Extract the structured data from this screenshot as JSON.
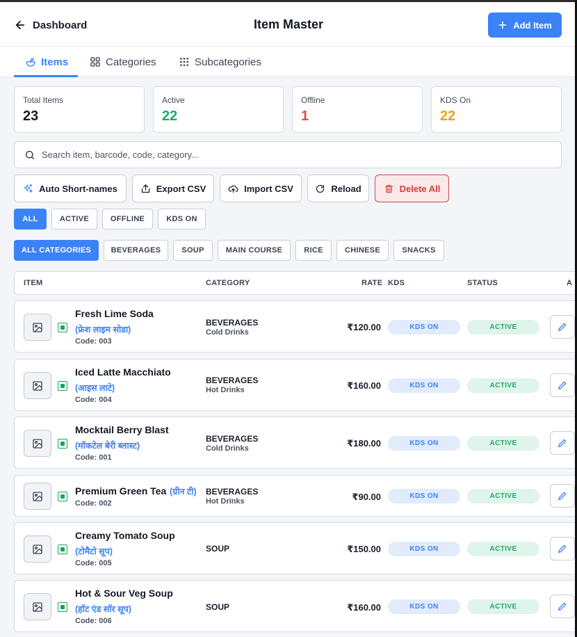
{
  "header": {
    "back_label": "Dashboard",
    "title": "Item Master",
    "add_label": "Add Item"
  },
  "tabs": [
    {
      "label": "Items",
      "active": true
    },
    {
      "label": "Categories",
      "active": false
    },
    {
      "label": "Subcategories",
      "active": false
    }
  ],
  "stats": [
    {
      "label": "Total Items",
      "value": "23",
      "color": "#141824"
    },
    {
      "label": "Active",
      "value": "22",
      "color": "#22a86a"
    },
    {
      "label": "Offline",
      "value": "1",
      "color": "#e04a4a"
    },
    {
      "label": "KDS On",
      "value": "22",
      "color": "#f0a020"
    }
  ],
  "search": {
    "placeholder": "Search item, barcode, code, category...",
    "value": ""
  },
  "actions": {
    "auto_short": "Auto Short-names",
    "export_csv": "Export CSV",
    "import_csv": "Import CSV",
    "reload": "Reload",
    "delete_all": "Delete All"
  },
  "status_filters": {
    "all": "ALL",
    "active": "ACTIVE",
    "offline": "OFFLINE",
    "kds_on": "KDS ON"
  },
  "category_filters": {
    "all": "ALL CATEGORIES",
    "beverages": "BEVERAGES",
    "soup": "SOUP",
    "main_course": "MAIN COURSE",
    "rice": "RICE",
    "chinese": "CHINESE",
    "snacks": "SNACKS"
  },
  "table": {
    "headers": {
      "item": "ITEM",
      "category": "CATEGORY",
      "rate": "RATE",
      "kds": "KDS",
      "status": "STATUS",
      "actions": "A"
    },
    "rows": [
      {
        "name": "Fresh Lime Soda",
        "alt": "(फ्रेश लाइम सोडा)",
        "code": "Code: 003",
        "category": "BEVERAGES",
        "subcategory": "Cold Drinks",
        "rate": "₹120.00",
        "kds": "KDS ON",
        "status": "ACTIVE"
      },
      {
        "name": "Iced Latte Macchiato",
        "alt": "(आइस लाटे)",
        "code": "Code: 004",
        "category": "BEVERAGES",
        "subcategory": "Hot Drinks",
        "rate": "₹160.00",
        "kds": "KDS ON",
        "status": "ACTIVE"
      },
      {
        "name": "Mocktail Berry Blast",
        "alt": "(मॉकटेल बेरी ब्लास्ट)",
        "code": "Code: 001",
        "category": "BEVERAGES",
        "subcategory": "Cold Drinks",
        "rate": "₹180.00",
        "kds": "KDS ON",
        "status": "ACTIVE"
      },
      {
        "name": "Premium Green Tea",
        "alt": "(ग्रीन टी)",
        "code": "Code: 002",
        "category": "BEVERAGES",
        "subcategory": "Hot Drinks",
        "rate": "₹90.00",
        "kds": "KDS ON",
        "status": "ACTIVE"
      },
      {
        "name": "Creamy Tomato Soup",
        "alt": "(टोमैटो सूप)",
        "code": "Code: 005",
        "category": "SOUP",
        "subcategory": "",
        "rate": "₹150.00",
        "kds": "KDS ON",
        "status": "ACTIVE"
      },
      {
        "name": "Hot & Sour Veg Soup",
        "alt": "(हॉट एंड सॉर सूप)",
        "code": "Code: 006",
        "category": "SOUP",
        "subcategory": "",
        "rate": "₹160.00",
        "kds": "KDS ON",
        "status": "ACTIVE"
      }
    ]
  },
  "colors": {
    "accent": "#3b82f6",
    "veg_mark": "#1aa35a",
    "active_pill_bg": "#dff4ea",
    "kds_pill_bg": "#e1ebfb",
    "danger": "#d33b3b"
  }
}
